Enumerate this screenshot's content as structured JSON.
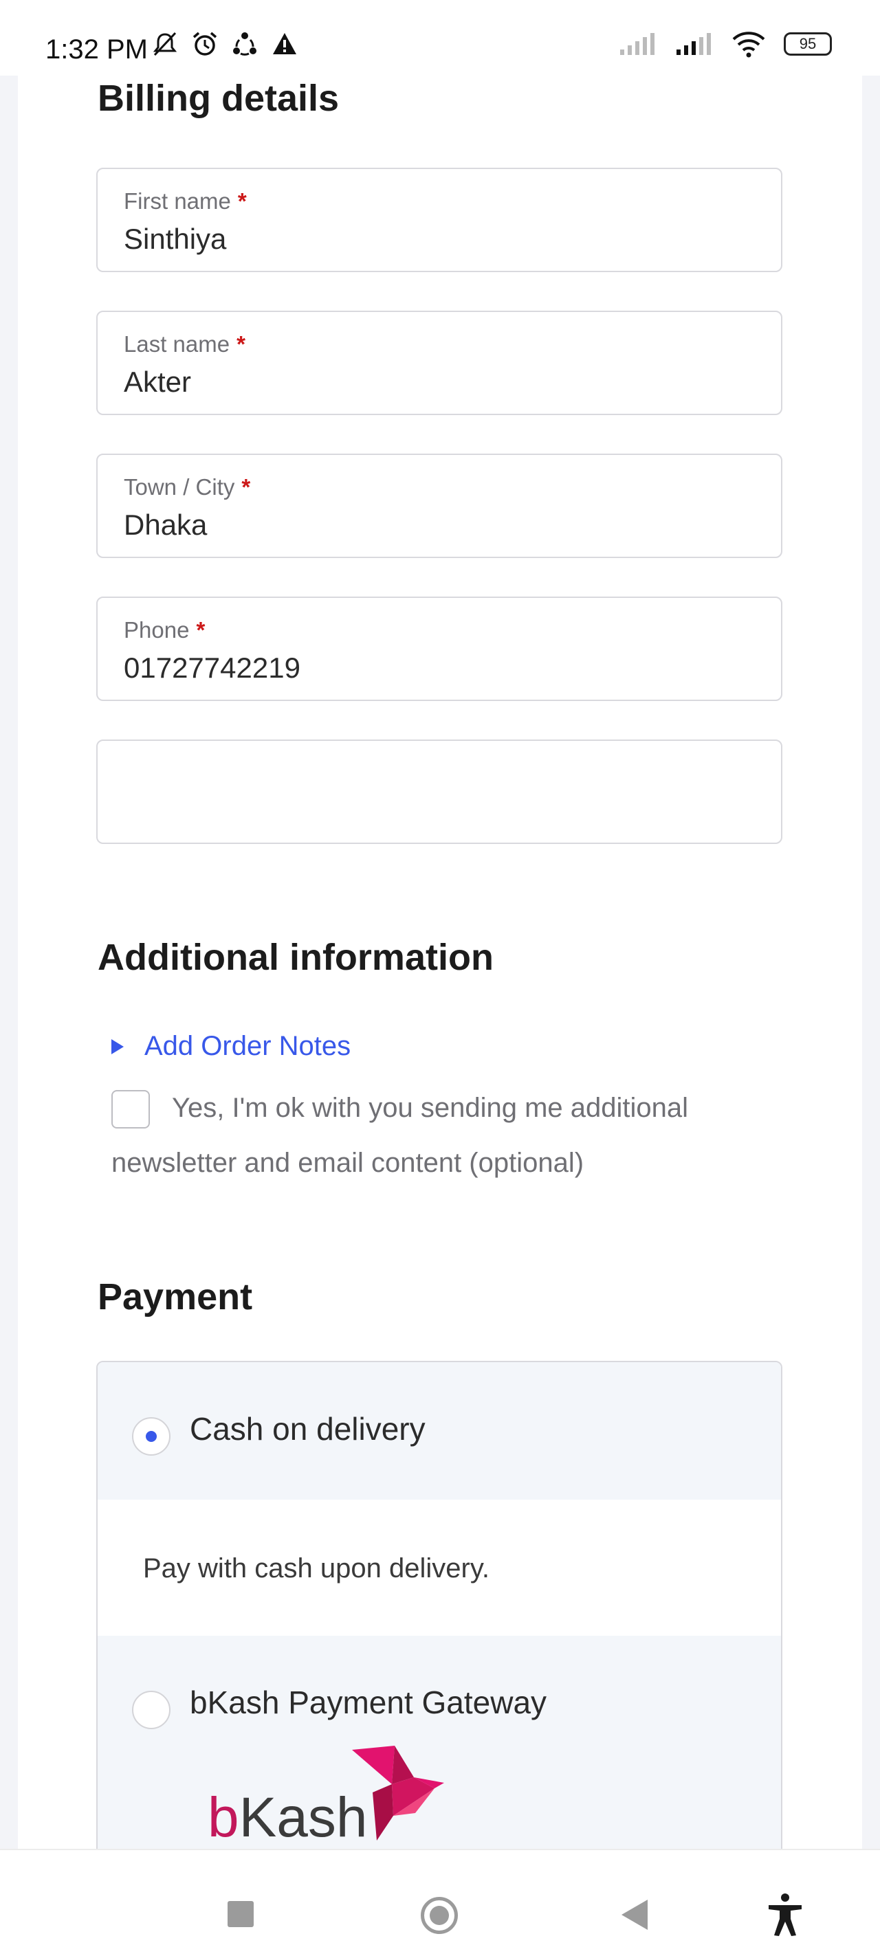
{
  "status_bar": {
    "time": "1:32 PM",
    "battery": "95",
    "icons": [
      "mute-icon",
      "alarm-icon",
      "sync-icon",
      "warning-icon",
      "signal-icon",
      "signal-icon",
      "wifi-icon",
      "battery-icon"
    ]
  },
  "billing": {
    "heading": "Billing details",
    "fields": [
      {
        "label": "First name",
        "required_mark": "*",
        "value": "Sinthiya"
      },
      {
        "label": "Last name",
        "required_mark": "*",
        "value": "Akter"
      },
      {
        "label": "Town / City",
        "required_mark": "*",
        "value": "Dhaka"
      },
      {
        "label": "Phone",
        "required_mark": "*",
        "value": "01727742219"
      },
      {
        "label": "",
        "value": ""
      }
    ]
  },
  "additional": {
    "heading": "Additional information",
    "notes_link": "Add Order Notes",
    "newsletter_text": "Yes, I'm ok with you sending me additional newsletter and email content (optional)",
    "newsletter_checked": false
  },
  "payment": {
    "heading": "Payment",
    "options": [
      {
        "label": "Cash on delivery",
        "selected": true,
        "description": "Pay with cash upon delivery."
      },
      {
        "label": "bKash Payment Gateway",
        "selected": false
      }
    ],
    "bkash_logo": {
      "b": "b",
      "rest": "Kash"
    }
  },
  "colors": {
    "accent": "#3858e9",
    "required": "#cc1818",
    "bkash": "#e2136e"
  },
  "nav_bar": {
    "icons": [
      "recents-square-icon",
      "home-circle-icon",
      "back-triangle-icon",
      "accessibility-icon"
    ]
  }
}
